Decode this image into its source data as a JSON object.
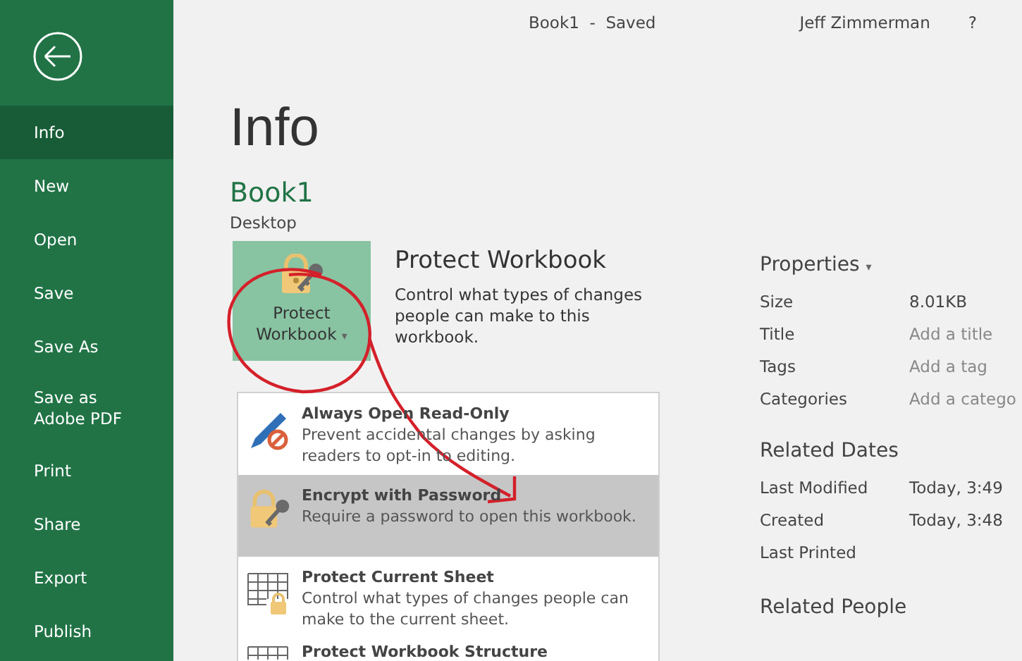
{
  "window": {
    "title": "Book1  -  Saved",
    "user": "Jeff Zimmerman",
    "help": "?"
  },
  "sidebar": {
    "items": [
      {
        "label": "Info",
        "selected": true
      },
      {
        "label": "New",
        "selected": false
      },
      {
        "label": "Open",
        "selected": false
      },
      {
        "label": "Save",
        "selected": false
      },
      {
        "label": "Save As",
        "selected": false
      },
      {
        "label": "Save as Adobe PDF",
        "selected": false
      },
      {
        "label": "Print",
        "selected": false
      },
      {
        "label": "Share",
        "selected": false
      },
      {
        "label": "Export",
        "selected": false
      },
      {
        "label": "Publish",
        "selected": false
      }
    ]
  },
  "page_title": "Info",
  "document": {
    "name": "Book1",
    "location": "Desktop"
  },
  "protect": {
    "button": "Protect Workbook",
    "caret": "▾",
    "heading": "Protect Workbook",
    "description": "Control what types of changes people can make to this workbook."
  },
  "menu": {
    "items": [
      {
        "kind": "read-only",
        "title": "Always Open Read-Only",
        "description": "Prevent accidental changes by asking readers to opt-in to editing.",
        "selected": false
      },
      {
        "kind": "encrypt",
        "title": "Encrypt with Password",
        "description": "Require a password to open this workbook.",
        "selected": true
      },
      {
        "kind": "sheet",
        "title": "Protect Current Sheet",
        "description": "Control what types of changes people can make to the current sheet.",
        "selected": false
      },
      {
        "kind": "structure",
        "title": "Protect Workbook Structure",
        "selected": false
      }
    ]
  },
  "properties": {
    "heading": "Properties",
    "caret": "▾",
    "rows": [
      {
        "label": "Size",
        "value": "8.01KB"
      },
      {
        "label": "Title",
        "placeholder": "Add a title"
      },
      {
        "label": "Tags",
        "placeholder": "Add a tag"
      },
      {
        "label": "Categories",
        "placeholder": "Add a catego"
      }
    ]
  },
  "related_dates": {
    "heading": "Related Dates",
    "rows": [
      {
        "label": "Last Modified",
        "value": "Today, 3:49"
      },
      {
        "label": "Created",
        "value": "Today, 3:48"
      },
      {
        "label": "Last Printed"
      }
    ]
  },
  "related_people": {
    "heading": "Related People"
  }
}
